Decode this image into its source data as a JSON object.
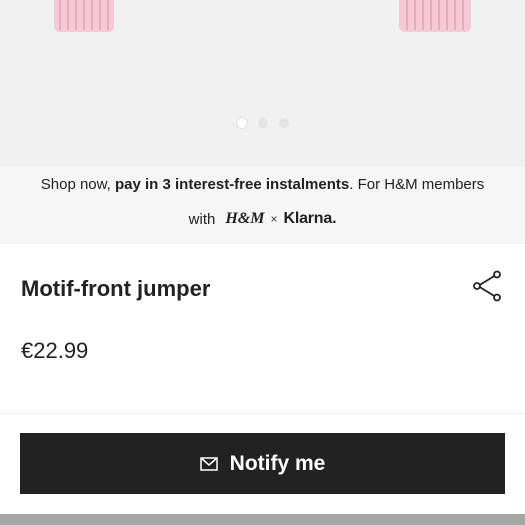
{
  "carousel": {
    "slide_count": 3,
    "active_index": 0,
    "product_color": "#f6c9d6"
  },
  "klarna": {
    "prefix": "Shop now,",
    "bold": "pay in 3 interest-free instalments",
    "suffix": ". For H&M members",
    "with": "with",
    "hm_logo": "H&M",
    "times": "×",
    "klarna_logo": "Klarna."
  },
  "product": {
    "title": "Motif-front jumper",
    "price": "€22.99"
  },
  "actions": {
    "share_icon": "share-icon",
    "notify_label": "Notify me",
    "notify_icon": "envelope-icon"
  },
  "colors": {
    "button_bg": "#222222",
    "banner_bg": "#f6f6f6",
    "image_bg": "#f1f1f1"
  }
}
